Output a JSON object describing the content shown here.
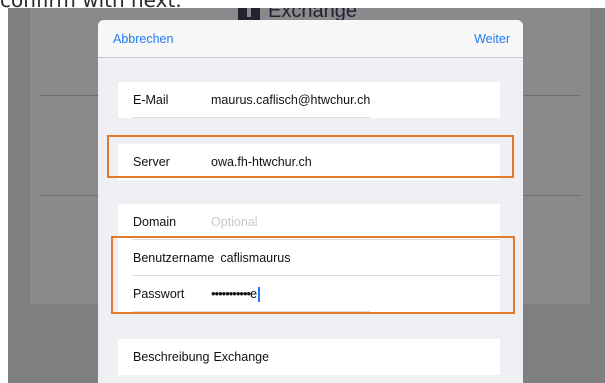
{
  "caption": {
    "text": "confirm with next."
  },
  "background": {
    "title": "Exchange",
    "logo_icon": "exchange-logo-icon"
  },
  "nav": {
    "cancel_label": "Abbrechen",
    "next_label": "Weiter"
  },
  "form": {
    "email": {
      "label": "E-Mail",
      "value": "maurus.caflisch@htwchur.ch"
    },
    "server": {
      "label": "Server",
      "value": "owa.fh-htwchur.ch"
    },
    "domain": {
      "label": "Domain",
      "placeholder": "Optional"
    },
    "username": {
      "label": "Benutzername",
      "value": "caflismaurus"
    },
    "password": {
      "label": "Passwort",
      "masked": "•••••••••••",
      "last_char": "e"
    },
    "description": {
      "label": "Beschreibung",
      "value": "Exchange"
    }
  },
  "colors": {
    "accent": "#1f7cf2",
    "highlight": "#e07a2c"
  }
}
